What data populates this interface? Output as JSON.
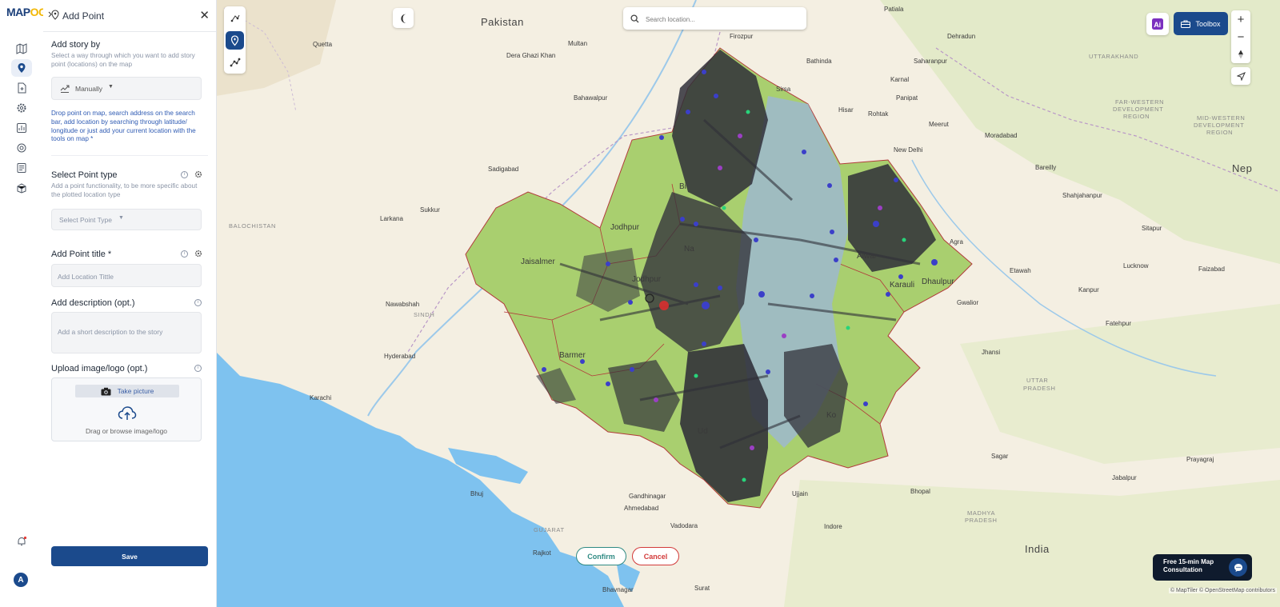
{
  "app": {
    "logo_main": "MAP",
    "logo_accent": "OG"
  },
  "rail": {
    "items": [
      {
        "icon": "map-icon"
      },
      {
        "icon": "location-pin-icon",
        "active": true
      },
      {
        "icon": "add-file-icon"
      },
      {
        "icon": "gear-cog-icon"
      },
      {
        "icon": "analytics-icon"
      },
      {
        "icon": "settings-icon"
      },
      {
        "icon": "report-icon"
      },
      {
        "icon": "data-icon"
      }
    ],
    "avatar_initial": "A"
  },
  "panel": {
    "title": "Add Point",
    "story_by": {
      "title": "Add story by",
      "subtitle": "Select a way through which you want to add story point (locations) on the map",
      "selected": "Manually"
    },
    "hint": "Drop point on map, search address on the search bar, add location by searching through latitude/ longitude or just add your current location with the tools on map *",
    "point_type": {
      "title": "Select Point type",
      "subtitle": "Add a point functionality, to be more specific about the plotted location type",
      "placeholder": "Select Point Type"
    },
    "point_title": {
      "title": "Add Point title *",
      "placeholder": "Add Location Tittle"
    },
    "description": {
      "title": "Add description (opt.)",
      "placeholder": "Add a short description to the story"
    },
    "upload": {
      "title": "Upload image/logo (opt.)",
      "take_picture": "Take picture",
      "drag_text": "Drag or browse image/logo"
    },
    "save_label": "Save"
  },
  "map": {
    "search_placeholder": "Search location...",
    "toolbox_label": "Toolbox",
    "ai_label": "Ai",
    "confirm_label": "Confirm",
    "cancel_label": "Cancel",
    "consult_line1": "Free 15-min Map",
    "consult_line2": "Consultation",
    "attribution": "© MapTiler © OpenStreetMap contributors",
    "colors": {
      "region_fill": "#a9cf6f",
      "region_border": "#b23a3a",
      "overlay": "#2f2f38",
      "water": "#7ec2ef",
      "land": "#f4efe2"
    },
    "labels": {
      "countries": [
        "Pakistan",
        "India",
        "Nep"
      ],
      "regions": [
        "UTTARAKHAND",
        "FAR-WESTERN",
        "DEVELOPMENT",
        "REGION",
        "MID-WESTERN",
        "DEVELOPMENT",
        "REGION",
        "BALOCHISTAN",
        "SINDH",
        "GUJARAT",
        "MADHYA",
        "PRADESH",
        "UTTAR",
        "PRADESH"
      ],
      "districts": [
        "Jaisalmer",
        "Jodhpur",
        "Jodhpur",
        "Barmer",
        "Karauli",
        "Dhaulpur",
        "Alwar",
        "Bi",
        "Na",
        "Ko",
        "Ud"
      ],
      "cities": [
        "Quetta",
        "Multan",
        "Dera Ghazi Khan",
        "Bahawalpur",
        "Sadigabad",
        "Larkana",
        "Sukkur",
        "Nawabshah",
        "Hyderabad",
        "Karachi",
        "Bhuj",
        "Gandhinagar",
        "Ahmedabad",
        "Rajkot",
        "Bhavnagar",
        "Surat",
        "Vadodara",
        "Indore",
        "Bhopal",
        "Sagar",
        "Jhansi",
        "Gwalior",
        "Fatehpur",
        "Kanpur",
        "Lucknow",
        "Faizabad",
        "Etawah",
        "Agra",
        "Moradabad",
        "Meerut",
        "New Delhi",
        "Bareilly",
        "Shahjahanpur",
        "Sitapur",
        "Saharanpur",
        "Dehradun",
        "Sirsa",
        "Hisar",
        "Panipat",
        "Karnal",
        "Patiala",
        "Firozpur",
        "Bathinda",
        "Rohtak",
        "Jabalpur",
        "Prayagraj",
        "Ujjain"
      ]
    }
  }
}
